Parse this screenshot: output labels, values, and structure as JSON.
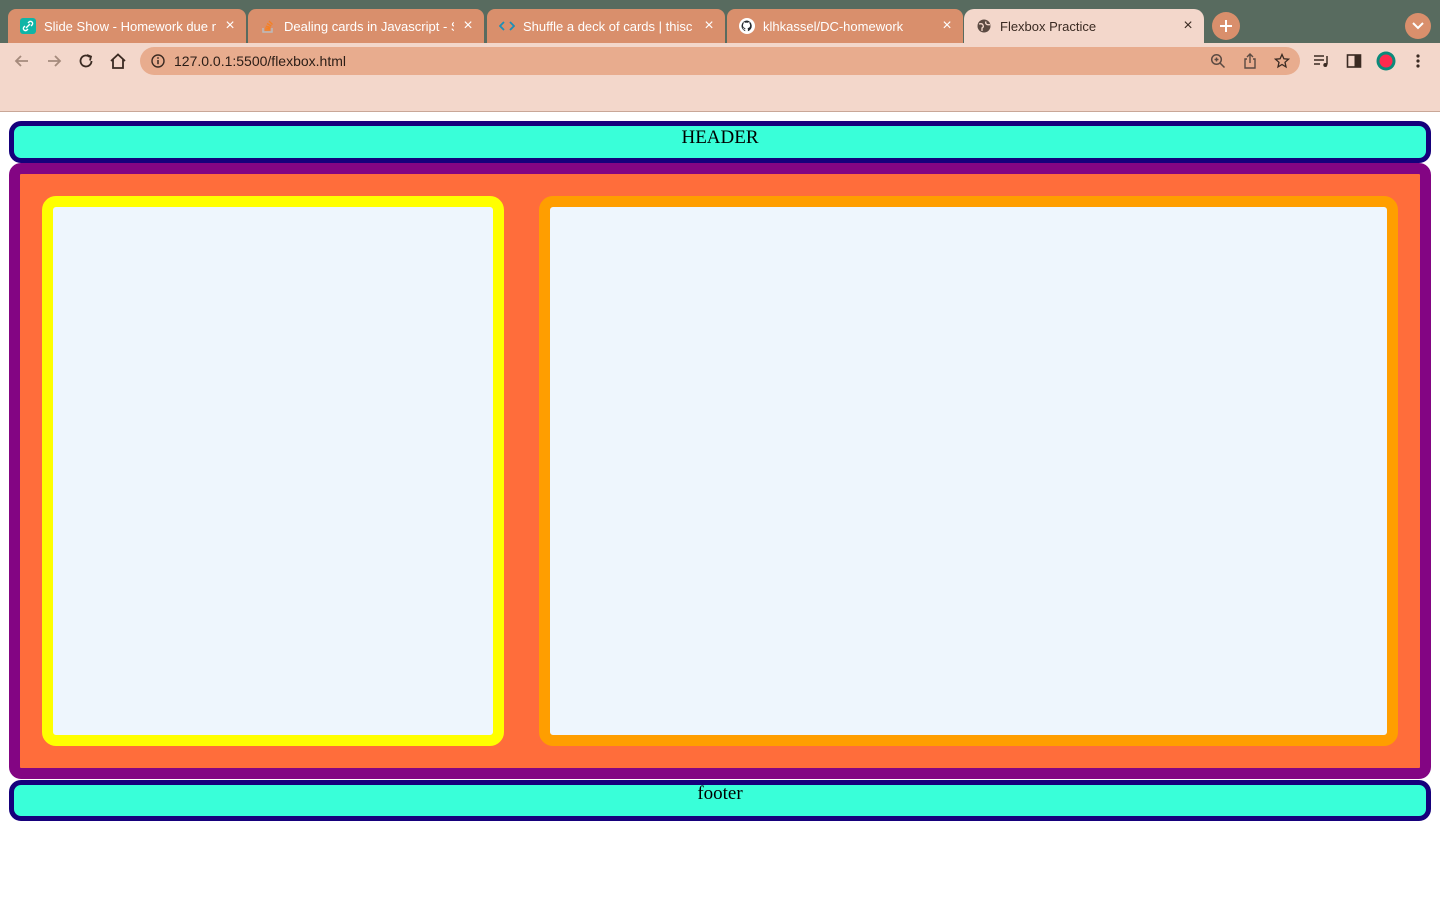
{
  "browser": {
    "tabs": [
      {
        "title": "Slide Show - Homework due n",
        "favicon": "link-icon",
        "active": false
      },
      {
        "title": "Dealing cards in Javascript - S",
        "favicon": "stack-overflow-icon",
        "active": false
      },
      {
        "title": "Shuffle a deck of cards | thisc",
        "favicon": "code-icon",
        "active": false
      },
      {
        "title": "klhkassel/DC-homework",
        "favicon": "github-icon",
        "active": false
      },
      {
        "title": "Flexbox Practice",
        "favicon": "globe-icon",
        "active": true
      }
    ],
    "url": "127.0.0.1:5500/flexbox.html",
    "colors": {
      "tabstrip": "#586b5f",
      "inactive_tab": "#d98f6c",
      "active_tab": "#f3d7cb",
      "omnibox": "#e8ac8e"
    }
  },
  "page": {
    "header_text": "HEADER",
    "footer_text": "footer",
    "colors": {
      "header_bg": "#39ffd9",
      "header_border": "#16007b",
      "main_bg": "#ff6d3b",
      "main_border": "#830583",
      "left_box_border": "#ffff00",
      "right_box_border": "#ff9e00",
      "box_bg": "#eef6fd"
    }
  }
}
